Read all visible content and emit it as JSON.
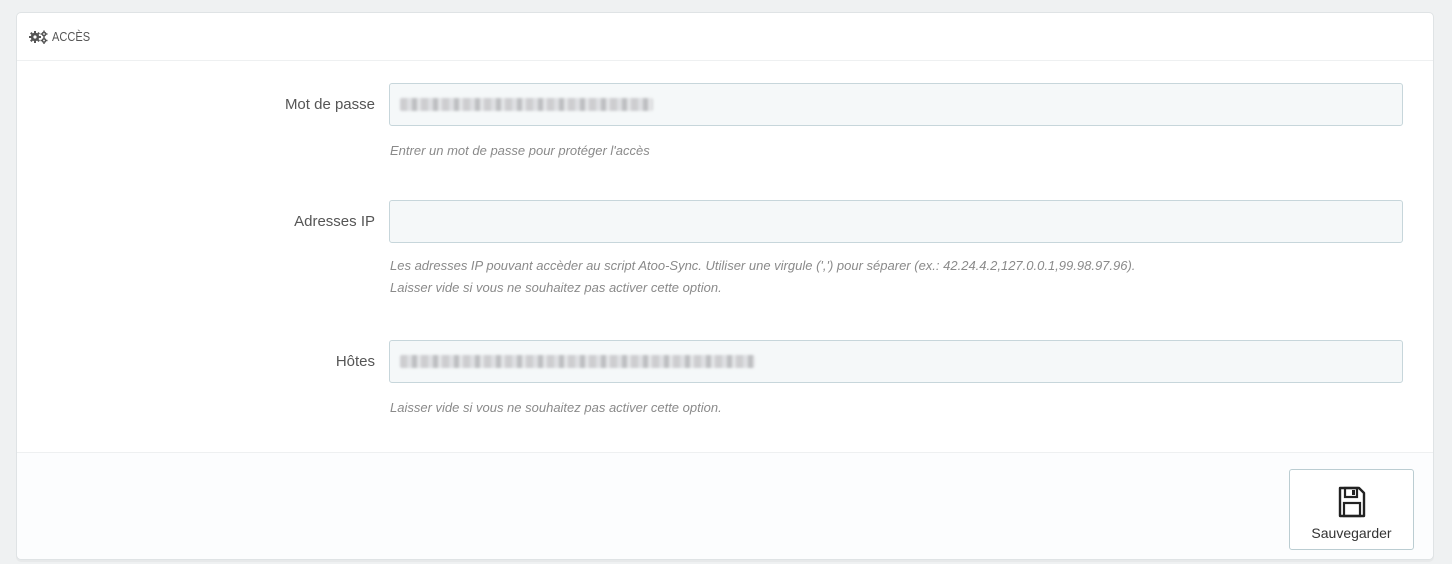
{
  "panel": {
    "title": "ACCÈS",
    "title_icon": "cogs-icon"
  },
  "fields": {
    "password": {
      "label": "Mot de passe",
      "help": "Entrer un mot de passe pour protéger l'accès"
    },
    "ip": {
      "label": "Adresses IP",
      "value": "",
      "help_line1": "Les adresses IP pouvant accèder au script Atoo-Sync. Utiliser une virgule (',') pour séparer (ex.: 42.24.4.2,127.0.0.1,99.98.97.96).",
      "help_line2": "Laisser vide si vous ne souhaitez pas activer cette option."
    },
    "hosts": {
      "label": "Hôtes",
      "help": "Laisser vide si vous ne souhaitez pas activer cette option."
    }
  },
  "footer": {
    "save_label": "Sauvegarder",
    "save_icon": "floppy-disk-icon"
  },
  "colors": {
    "input_bg": "#f5f8f9",
    "input_border": "#c7d6db",
    "help_text": "#8a8a8a"
  }
}
